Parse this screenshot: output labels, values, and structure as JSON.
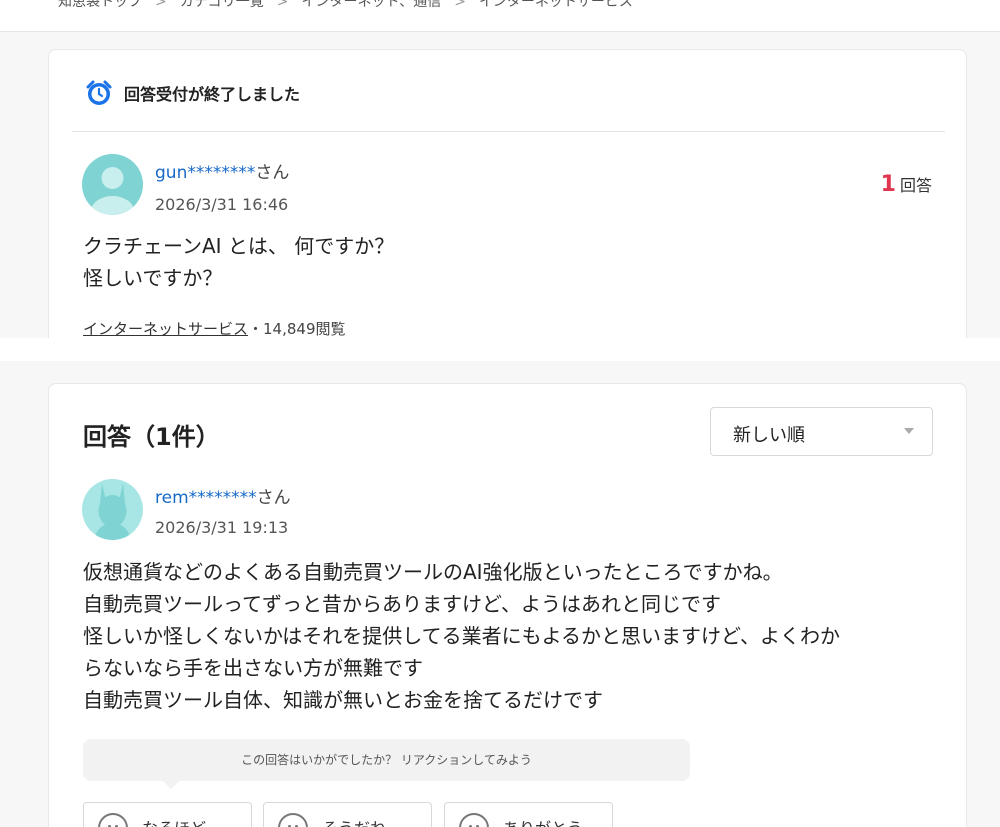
{
  "breadcrumb": [
    "知恵袋トップ",
    "カテゴリ一覧",
    "インターネット、通信",
    "インターネットサービス"
  ],
  "breadcrumb_separator": ">",
  "question": {
    "status": "回答受付が終了しました",
    "user": "gun********",
    "honorific": "さん",
    "date": "2026/3/31 16:46",
    "lines": [
      "クラチェーンAI とは、 何ですか？",
      "怪しいですか？"
    ],
    "category": "インターネットサービス",
    "views": "・14,849閲覧",
    "answer_count_num": "1",
    "answer_count_label": "回答"
  },
  "answers": {
    "title": "回答（1件）",
    "sort_label": "新しい順",
    "user": "rem********",
    "honorific": "さん",
    "date": "2026/3/31 19:13",
    "lines": [
      "仮想通貨などのよくある自動売買ツールのAI強化版といったところですかね。",
      "自動売買ツールってずっと昔からありますけど、ようはあれと同じです",
      "怪しいか怪しくないかはそれを提供してる業者にもよるかと思いますけど、よくわか",
      "らないなら手を出さない方が無難です",
      "自動売買ツール自体、知識が無いとお金を捨てるだけです"
    ],
    "reaction_prompt": "この回答はいかがでしたか？ リアクションしてみよう",
    "reactions": [
      "なるほど",
      "そうだね",
      "ありがとう"
    ]
  },
  "colors": {
    "link": "#1769c7",
    "accent": "#e0354f",
    "clock": "#1a73e8",
    "avatar": "#7fd3d3"
  },
  "icons": {
    "status": "alarm-clock-icon",
    "reaction": "face-icon"
  }
}
